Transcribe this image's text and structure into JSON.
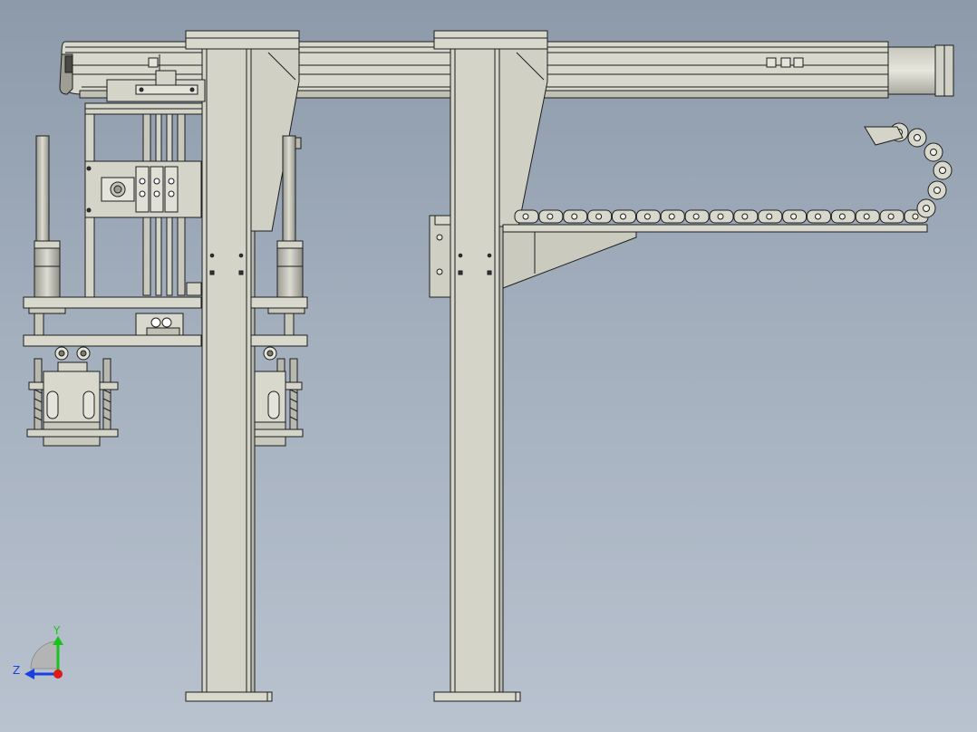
{
  "triad": {
    "y_label": "Y",
    "z_label": "Z",
    "y_color": "#19c319",
    "z_color": "#1a3fe0",
    "x_color": "#e01818"
  },
  "colors": {
    "background_top": "#8d9aaa",
    "background_bottom": "#b9c2cf",
    "part_fill": "#d4d4c8",
    "part_dark": "#9c9c92",
    "edge": "#1e1e1e"
  },
  "chain_links": 17
}
